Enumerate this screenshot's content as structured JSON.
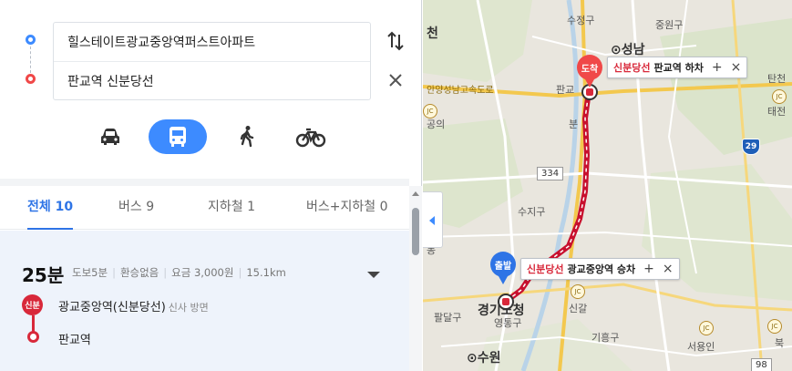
{
  "search": {
    "origin": "힐스테이트광교중앙역퍼스트아파트",
    "destination": "판교역 신분당선"
  },
  "modes": [
    {
      "name": "car",
      "icon": "car-icon",
      "active": false
    },
    {
      "name": "transit",
      "icon": "bus-icon",
      "active": true
    },
    {
      "name": "walk",
      "icon": "walk-icon",
      "active": false
    },
    {
      "name": "bike",
      "icon": "bike-icon",
      "active": false
    }
  ],
  "tabs": [
    {
      "label": "전체",
      "count": "10"
    },
    {
      "label": "버스",
      "count": "9"
    },
    {
      "label": "지하철",
      "count": "1"
    },
    {
      "label": "버스+지하철",
      "count": "0"
    }
  ],
  "result": {
    "time": "25분",
    "walk": "도보5분",
    "transfer": "환승없음",
    "fare": "요금 3,000원",
    "distance": "15.1km",
    "line_badge": "신분",
    "board_stop": "광교중앙역(신분당선)",
    "board_dir": "신사 방면",
    "alight_stop": "판교역"
  },
  "map": {
    "labels": [
      "수정구",
      "중원구",
      "성남",
      "안양성남고속도로",
      "판교",
      "분",
      "수지구",
      "경기도청",
      "팔달구",
      "영통구",
      "신갈",
      "기흥구",
      "수원",
      "서용인",
      "탄천",
      "태전",
      "천",
      "동",
      "공의",
      "북"
    ],
    "arrive_pin": "도착",
    "depart_pin": "출발",
    "arrive_callout": {
      "line": "신분당선",
      "station": "판교역 하차",
      "add": "+",
      "close": "×"
    },
    "depart_callout": {
      "line": "신분당선",
      "station": "광교중앙역 승차",
      "add": "+",
      "close": "×"
    },
    "route_numbers": [
      "334",
      "29",
      "98"
    ],
    "jc": "JC",
    "colors": {
      "route_line": "#c8102e",
      "accent": "#3d8bff",
      "arrive": "#f04848",
      "depart": "#2e74e6"
    }
  }
}
